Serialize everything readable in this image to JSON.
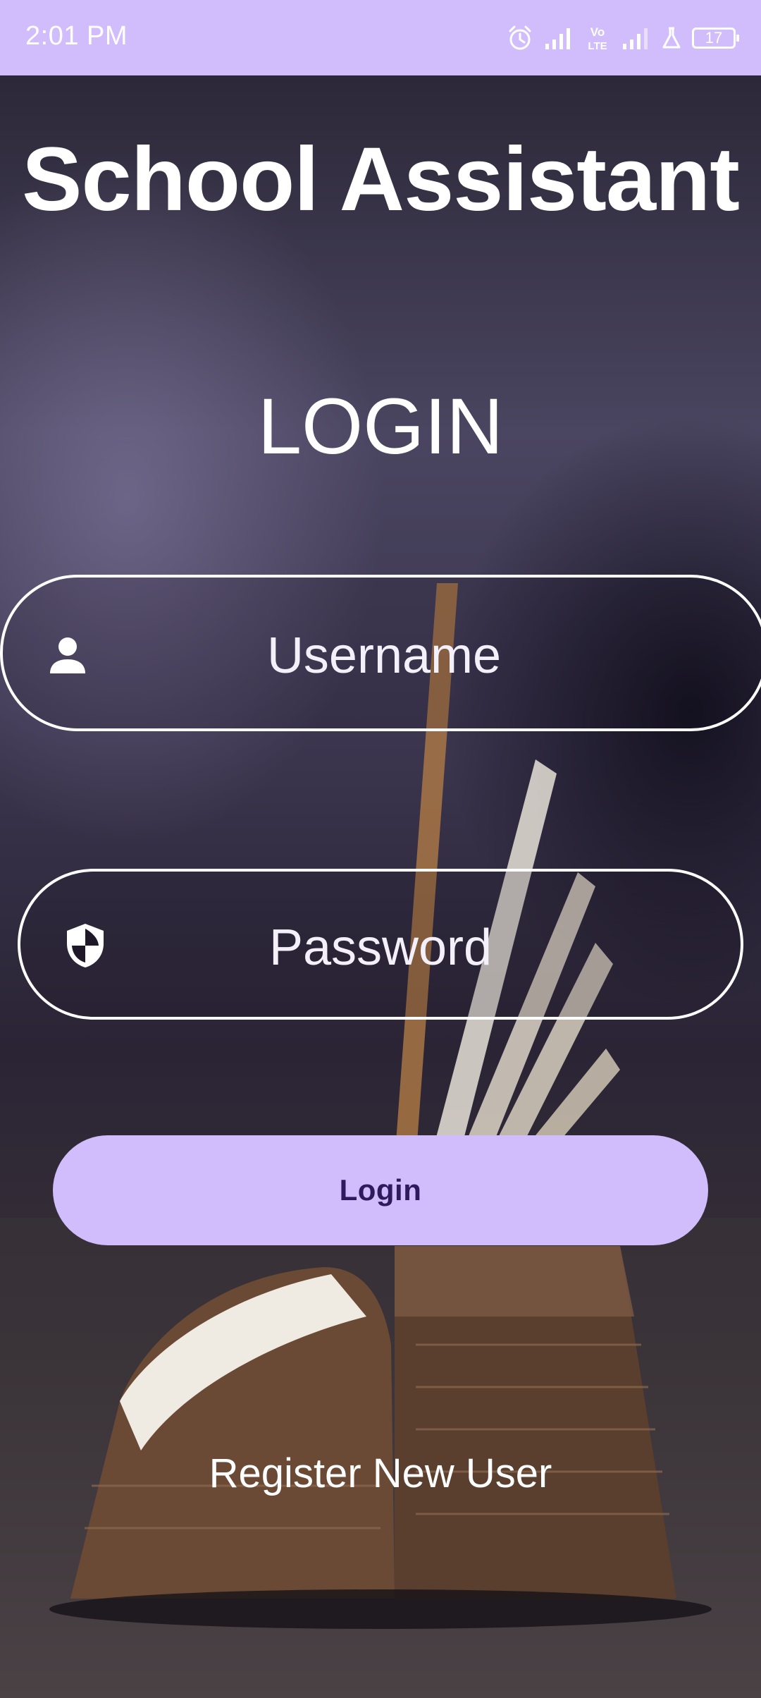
{
  "status_bar": {
    "time": "2:01 PM",
    "network_label": "Vo LTE",
    "battery_level": "17",
    "background_color": "#d1bcfc",
    "icons": [
      "alarm-icon",
      "signal-icon",
      "volte-icon",
      "signal-icon",
      "lab-flask-icon",
      "battery-icon"
    ]
  },
  "app": {
    "title": "School Assistant",
    "heading": "LOGIN"
  },
  "form": {
    "username_placeholder": "Username",
    "password_placeholder": "Password",
    "username_icon": "person-icon",
    "password_icon": "shield-icon",
    "login_button_label": "Login",
    "register_link_label": "Register New User"
  },
  "colors": {
    "accent": "#d1bcfc",
    "button_text": "#2f1a5e",
    "text": "#ffffff"
  }
}
